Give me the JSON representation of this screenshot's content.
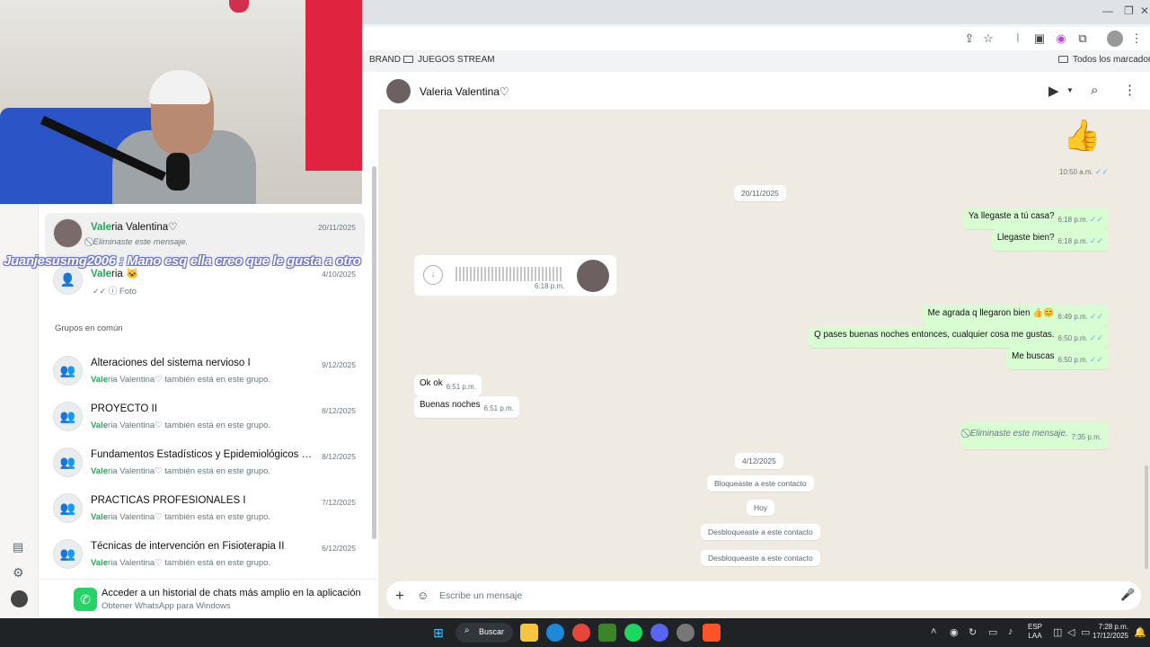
{
  "bookmarks": {
    "brand": "BRAND",
    "stream": "JUEGOS STREAM",
    "all": "Todos los marcadores"
  },
  "overlay": "Juanjesusmg2006 : Mano esq ella creo que le gusta a otro",
  "contact_rows": [
    {
      "name_highlight": "Vale",
      "name_rest": "ria Valentina♡",
      "subtitle": "Eliminaste este mensaje.",
      "date": "20/11/2025"
    },
    {
      "name_highlight": "Vale",
      "name_rest": "ria 🐱",
      "subtitle": "Foto",
      "date": "4/10/2025"
    }
  ],
  "groups_title": "Grupos en común",
  "groups": [
    {
      "name": "Alteraciones del sistema nervioso I",
      "member_highlight": "Vale",
      "member_rest": "ria Valentina♡",
      "suffix": " también está en este grupo.",
      "date": "9/12/2025"
    },
    {
      "name": "PROYECTO II",
      "member_highlight": "Vale",
      "member_rest": "ria Valentina♡",
      "suffix": " también está en este grupo.",
      "date": "8/12/2025"
    },
    {
      "name": "Fundamentos Estadísticos y Epidemiológicos en Sa...",
      "member_highlight": "Vale",
      "member_rest": "ria Valentina♡",
      "suffix": " también está en este grupo.",
      "date": "8/12/2025"
    },
    {
      "name": "PRÁCTICAS PROFESIONALES I",
      "member_highlight": "Vale",
      "member_rest": "ria Valentina♡",
      "suffix": " también está en este grupo.",
      "date": "7/12/2025"
    },
    {
      "name": "Técnicas de intervención en Fisioterapia II",
      "member_highlight": "Vale",
      "member_rest": "ria Valentina♡",
      "suffix": " también está en este grupo.",
      "date": "6/12/2025"
    }
  ],
  "get_app": {
    "title": "Acceder a un historial de chats más amplio en la aplicación",
    "subtitle": "Obtener WhatsApp para Windows"
  },
  "chat": {
    "contact": "Valeria Valentina♡",
    "messages": {
      "thumb_emoji": "👍",
      "thumb_time": "10:50 a.m.",
      "date1": "20/11/2025",
      "m1": "Ya llegaste a tú casa?",
      "m1_time": "6:18 p.m.",
      "m2": "Llegaste bien?",
      "m2_time": "6:18 p.m.",
      "voice_time": "6:18 p.m.",
      "m3": "Me agrada q llegaron bien 👍😊",
      "m3_time": "6:49 p.m.",
      "m4": "Q pases buenas noches entonces,  cualquier cosa me gustas.",
      "m4_time": "6:50 p.m.",
      "m5": "Me buscas",
      "m5_time": "6:50 p.m.",
      "r1": "Ok ok",
      "r1_time": "6:51 p.m.",
      "r2": "Buenas noches",
      "r2_time": "6:51 p.m.",
      "deleted": "Eliminaste este mensaje.",
      "deleted_time": "7:35 p.m.",
      "date2": "4/12/2025",
      "sys1": "Bloqueaste a este contacto",
      "today": "Hoy",
      "sys2": "Desbloqueaste a este contacto",
      "sys3": "Desbloqueaste a este contacto"
    },
    "composer_placeholder": "Escribe un mensaje"
  },
  "taskbar": {
    "search": "Buscar",
    "lang1": "ESP",
    "lang2": "LAA",
    "time": "7:28 p.m.",
    "date": "17/12/2025"
  },
  "colors": {
    "accent": "#25d366",
    "outgoing": "#d9fdd3",
    "chat_bg": "#efeae2",
    "read_tick": "#53bdeb"
  }
}
